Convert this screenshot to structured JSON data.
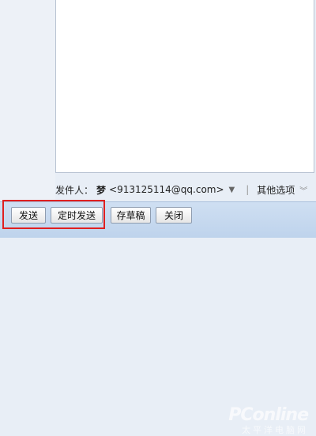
{
  "sender": {
    "label": "发件人：",
    "name": "梦",
    "email": "<913125114@qq.com>",
    "dropdown_icon": "triangle-down-icon",
    "more_options_label": "其他选项",
    "more_options_icon": "double-chevron-down-icon"
  },
  "toolbar": {
    "send_label": "发送",
    "timed_send_label": "定时发送",
    "save_draft_label": "存草稿",
    "close_label": "关闭"
  },
  "watermark": {
    "brand": "PConline",
    "tagline": "太平洋电脑网"
  },
  "colors": {
    "highlight": "#e02020",
    "toolbar_bg": "#c7dbf1"
  }
}
